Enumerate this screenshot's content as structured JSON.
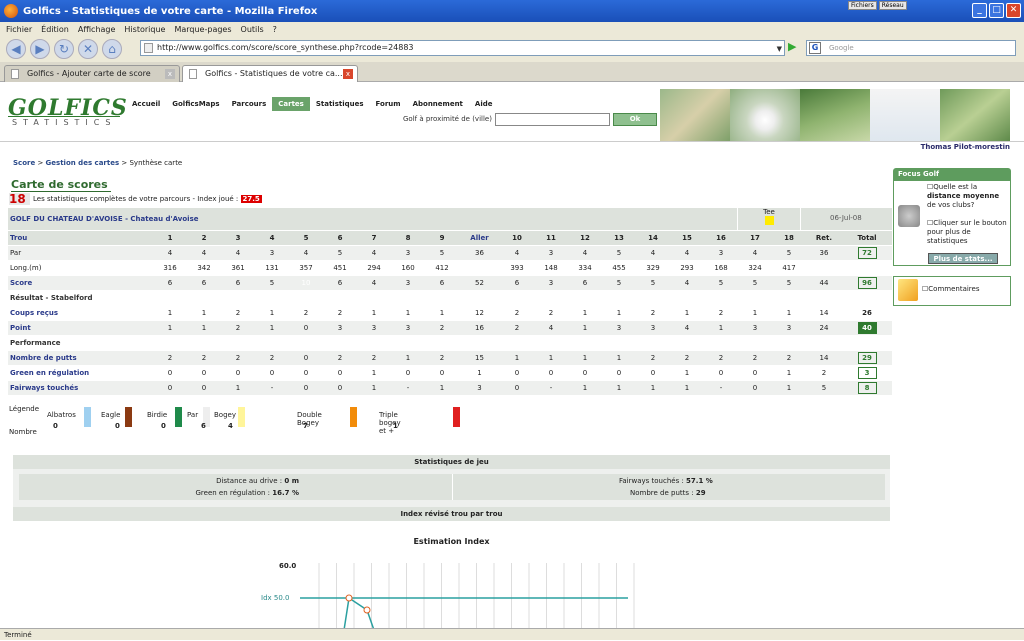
{
  "window": {
    "title": "Golfics - Statistiques de votre carte - Mozilla Firefox",
    "mini_btn_1": "Fichiers",
    "mini_btn_2": "Réseau"
  },
  "menu": [
    "Fichier",
    "Édition",
    "Affichage",
    "Historique",
    "Marque-pages",
    "Outils",
    "?"
  ],
  "nav": {
    "url": "http://www.golfics.com/score/score_synthese.php?rcode=24883",
    "search_placeholder": "Google"
  },
  "tabs": [
    {
      "label": "Golfics - Ajouter carte de score"
    },
    {
      "label": "Golfics - Statistiques de votre ca..."
    }
  ],
  "status": "Terminé",
  "site": {
    "logo": "GOLFICS",
    "logo_sub": "STATISTICS",
    "nav": [
      "Accueil",
      "GolficsMaps",
      "Parcours",
      "Cartes",
      "Statistiques",
      "Forum",
      "Abonnement",
      "Aide"
    ],
    "active_nav": "Cartes",
    "prox_label": "Golf à proximité de (ville)",
    "ok": "Ok",
    "user": "Thomas Pilot-morestin"
  },
  "breadcrumb": {
    "a": "Score",
    "b": "Gestion des cartes",
    "c": "Synthèse carte",
    "sep": ">"
  },
  "card": {
    "title": "Carte de scores",
    "holes": "18",
    "stats_text": "Les statistiques complètes de votre parcours - Index joué :",
    "index": "27.5",
    "course": "GOLF DU CHATEAU D'AVOISE - Chateau d'Avoise",
    "tee_label": "Tee",
    "date": "06-Jul-08"
  },
  "table": {
    "headers": {
      "trou": "Trou",
      "aller": "Aller",
      "ret": "Ret.",
      "total": "Total"
    },
    "holes": [
      "1",
      "2",
      "3",
      "4",
      "5",
      "6",
      "7",
      "8",
      "9",
      "10",
      "11",
      "12",
      "13",
      "14",
      "15",
      "16",
      "17",
      "18"
    ],
    "rows": [
      {
        "label": "Par",
        "out": [
          "4",
          "4",
          "4",
          "3",
          "4",
          "5",
          "4",
          "3",
          "5"
        ],
        "aller": "36",
        "in": [
          "4",
          "3",
          "4",
          "5",
          "4",
          "4",
          "3",
          "4",
          "5"
        ],
        "ret": "36",
        "total": "72",
        "style": "g"
      },
      {
        "label": "Long.(m)",
        "out": [
          "316",
          "342",
          "361",
          "131",
          "357",
          "451",
          "294",
          "160",
          "412"
        ],
        "aller": "",
        "in": [
          "393",
          "148",
          "334",
          "455",
          "329",
          "293",
          "168",
          "324",
          "417"
        ],
        "ret": "",
        "total": "",
        "style": "w"
      },
      {
        "label": "Score",
        "out": [
          "6",
          "6",
          "6",
          "5",
          "10",
          "6",
          "4",
          "3",
          "6"
        ],
        "aller": "52",
        "in": [
          "6",
          "3",
          "6",
          "5",
          "5",
          "4",
          "5",
          "5",
          "5"
        ],
        "ret": "44",
        "total": "96",
        "style": "g",
        "bold": true,
        "colors_out": [
          "or",
          "or",
          "or",
          "or",
          "red",
          "yel",
          "",
          "",
          "yel"
        ],
        "colors_in": [
          "or",
          "",
          "or",
          "",
          "yel",
          "",
          "or",
          "yel",
          ""
        ]
      },
      {
        "label": "Résultat - Stabelford",
        "section": true
      },
      {
        "label": "Coups reçus",
        "out": [
          "1",
          "1",
          "2",
          "1",
          "2",
          "2",
          "1",
          "1",
          "1"
        ],
        "aller": "12",
        "in": [
          "2",
          "2",
          "1",
          "1",
          "2",
          "1",
          "2",
          "1",
          "1"
        ],
        "ret": "14",
        "total": "26",
        "style": "w",
        "bold": true,
        "plaintotal": true
      },
      {
        "label": "Point",
        "out": [
          "1",
          "1",
          "2",
          "1",
          "0",
          "3",
          "3",
          "3",
          "2"
        ],
        "aller": "16",
        "in": [
          "2",
          "4",
          "1",
          "3",
          "3",
          "4",
          "1",
          "3",
          "3"
        ],
        "ret": "24",
        "total": "40",
        "style": "g",
        "bold": true,
        "filltotal": true
      },
      {
        "label": "Performance",
        "section": true
      },
      {
        "label": "Nombre de putts",
        "out": [
          "2",
          "2",
          "2",
          "2",
          "0",
          "2",
          "2",
          "1",
          "2"
        ],
        "aller": "15",
        "in": [
          "1",
          "1",
          "1",
          "1",
          "2",
          "2",
          "2",
          "2",
          "2"
        ],
        "ret": "14",
        "total": "29",
        "style": "g",
        "bold": true
      },
      {
        "label": "Green en régulation",
        "out": [
          "0",
          "0",
          "0",
          "0",
          "0",
          "0",
          "1",
          "0",
          "0"
        ],
        "aller": "1",
        "in": [
          "0",
          "0",
          "0",
          "0",
          "0",
          "1",
          "0",
          "0",
          "1"
        ],
        "ret": "2",
        "total": "3",
        "style": "w",
        "bold": true
      },
      {
        "label": "Fairways touchés",
        "out": [
          "0",
          "0",
          "1",
          "-",
          "0",
          "0",
          "1",
          "-",
          "1"
        ],
        "aller": "3",
        "in": [
          "0",
          "-",
          "1",
          "1",
          "1",
          "1",
          "-",
          "0",
          "1"
        ],
        "ret": "5",
        "total": "8",
        "style": "g",
        "bold": true
      }
    ]
  },
  "legend": {
    "title": "Légende",
    "nombre": "Nombre",
    "items": [
      {
        "label": "Albatros",
        "count": "0",
        "color": "#9fd0f0"
      },
      {
        "label": "Eagle",
        "count": "0",
        "color": "#8b3a12"
      },
      {
        "label": "Birdie",
        "count": "0",
        "color": "#1f8a4a"
      },
      {
        "label": "Par",
        "count": "6",
        "color": "#eeeeee"
      },
      {
        "label": "Bogey",
        "count": "4",
        "color": "#fff59a"
      },
      {
        "label": "Double Bogey",
        "count": "7",
        "color": "#f28c0a"
      },
      {
        "label": "Triple bogey et +",
        "count": "1",
        "color": "#e02020"
      }
    ]
  },
  "stats": {
    "header": "Statistiques de jeu",
    "drive_label": "Distance au drive :",
    "drive_val": "0 m",
    "green_label": "Green en régulation :",
    "green_val": "16.7 %",
    "fair_label": "Fairways touchés :",
    "fair_val": "57.1 %",
    "putts_label": "Nombre de putts :",
    "putts_val": "29"
  },
  "index_header": "Index révisé trou par trou",
  "chart_data": {
    "type": "line",
    "title": "Estimation Index",
    "ytick": "60.0",
    "ref_label": "Idx 50.0",
    "ylim": [
      50,
      60
    ],
    "points": [
      [
        1,
        50
      ],
      [
        2,
        49
      ]
    ]
  },
  "side": {
    "focus": "Focus Golf",
    "q1a": "Quelle est la",
    "q1b": "distance moyenne",
    "q1c": "de vos clubs?",
    "q2": "Cliquer sur le bouton pour plus de statistiques",
    "btn": "Plus de stats...",
    "comments": "Commentaires"
  }
}
